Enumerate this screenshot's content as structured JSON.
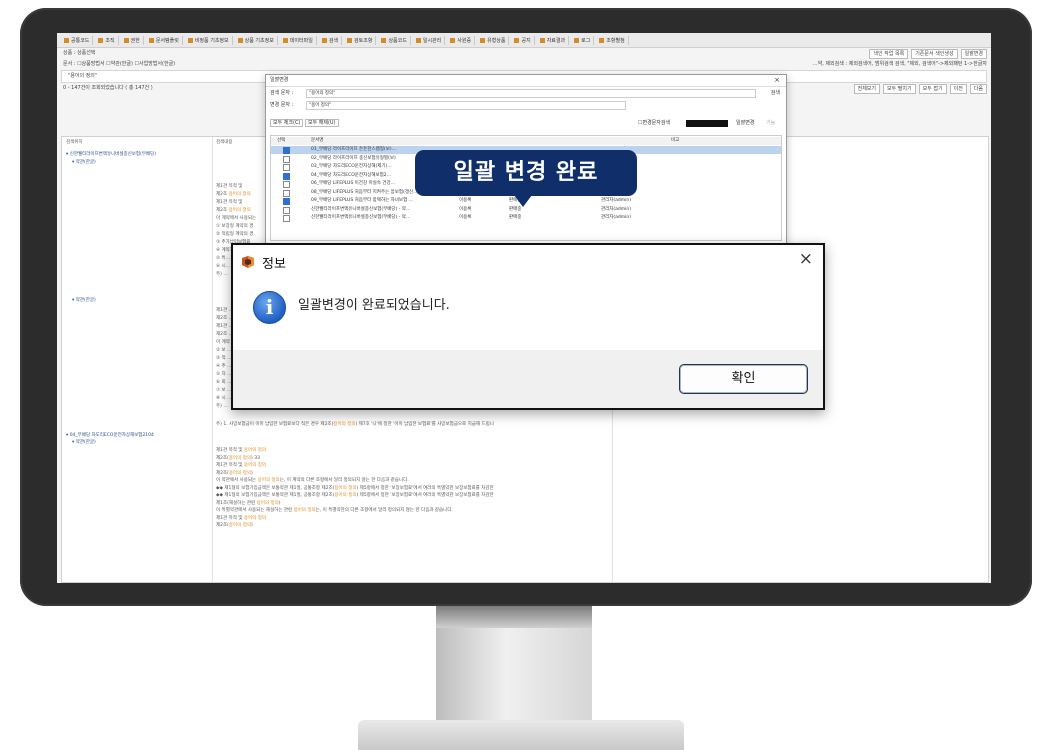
{
  "toolbar_items": [
    "공통코드",
    "조직",
    "권한",
    "문서템플릿",
    "비정품 기초정보",
    "상품 기초정보",
    "데이터파일",
    "검색",
    "검토조항",
    "상품코드",
    "일시관리",
    "사원증",
    "유형상품",
    "공지",
    "자료결과",
    "로그",
    "조항별첨"
  ],
  "filter_row": {
    "label1": "상품 :",
    "value1": "상품선택",
    "right_buttons": [
      "색인 작업 목록",
      "기존문서 색인생성",
      "일괄변경"
    ]
  },
  "option_row": {
    "text": "문서 : ☐상품방법서 ☐약관(한글) ☐사업방법서(한글)",
    "right_text": "…약, 제외검색 : 제외검색어, 범위검색 검색, \"제외, 검색어\"->제외패턴 1->한글자"
  },
  "search_value": "\"용어의 정의\"",
  "result_count": "0 - 147건이 조회되었습니다 ( 총 147건 )",
  "result_buttons": [
    "전체보기",
    "모두 펼치기",
    "모두 접기",
    "이전",
    "다음"
  ],
  "grid": {
    "col1_header": "검색위치",
    "col2_header": "검색내용",
    "tree_group1": "▾ 신한웰티라이프변액유니버셜종신보험(무배당)",
    "tree_sub1": "▾ 약관(한글)",
    "tree_sub2": "▾ 약관(한글)",
    "tree_group2": "▾ 04_무배당 차도리ECO운전자상해보험2104",
    "tree_sub3": "▾ 약관(한글)",
    "lines_top": [
      "제1관 목적 및",
      "제2조 용어의 정의",
      "제1관 목적 및",
      "제2조 용어의 정의",
      "이 계약에서 사용되는",
      "① 보장형 계약의 경",
      "② 적립형 계약의 경",
      "③ 추가납입보험료",
      "④ 계약자가 납입한",
      "⑤ 특…",
      "⑥ 시…",
      "주) …"
    ],
    "lines_mid": [
      "제1관 …",
      "제2조 …",
      "제1관 …",
      "제2조 …",
      "이 계약 …",
      "② 보 …",
      "③ 적 …",
      "④ 추 …",
      "⑤ 자 …",
      "⑥ 회 …",
      "⑦ 보 …",
      "⑧ 시 …",
      "주) …"
    ],
    "line_note": "주) 1. 사망보험금이 이미 납입한 보험료보다 적은 경우 제2조(용어의 정의) 제7호 '나'에 정한 '이미 납입한 보험료'를 사망보험금으로 지급해 드립니",
    "lines_bottom": [
      "제1관 목적 및 용어의 정의",
      "제2조(용어의 정의) 33",
      "제1관 목적 및 용어의 정의",
      "제2조(용어의 정의)",
      "이 약관에서 사용되는 용어의 정의는, 이 계약의 다른 조항에서 달리 정의되지 않는 한 다음과 같습니다.",
      "◆◆ 제1형의 보험기입금액은 보통약관 제1절, 공통조항 제2조(용어의 정의) 제5항에서 정한 '보장보험료'에서 여러의 특별약관 보장보험료를 차감한",
      "◆◆ 제1형의 보험기입금액은 보통약관 제1절, 공통조항 제2조(용어의 정의) 제5항에서 정한 '보장보험료'에서 여러의 특별약관 보장보험료를 차감한",
      "제1조(해설하는 관련 용어의 정의)",
      "이 특별약관에서 사용되는 해설하는 관련 용어의 정의는, 이 특별약관의 다른 조항에서 달리 정의되지 않는 한 다음과 같습니다.",
      "제1관 목적 및 용어의 정의",
      "제2조(용어의 정의)"
    ]
  },
  "bg_dialog": {
    "title": "일괄변경",
    "close": "×",
    "search_label": "검색 문자 :",
    "search_value": "\"용어의 정의\"",
    "search_btn": "검색",
    "change_label": "변경 문자 :",
    "change_value": "\"용어 정의\"",
    "select_all": "모두 체크(C)",
    "deselect_all": "모두 해제(U)",
    "change_check_label": "☐변경문자검색",
    "bulk_btn": "일괄변경",
    "other_btn": "기능",
    "col_select": "선택",
    "col_doc": "문서명",
    "col_note": "비고",
    "rows": [
      {
        "checked": true,
        "selected": true,
        "name": "01_무배당 라이프라이프 든든한스팸형(보)…",
        "author": "",
        "status": "",
        "admin": ""
      },
      {
        "checked": false,
        "selected": false,
        "name": "02_무배당 라이프라이프 종신보험유형별(보)",
        "author": "",
        "status": "",
        "admin": ""
      },
      {
        "checked": false,
        "selected": false,
        "name": "03_무배당 차도리ECO운전자상해(제기)…",
        "author": "",
        "status": "",
        "admin": ""
      },
      {
        "checked": true,
        "selected": false,
        "name": "04_무배당 차도리ECO운전자상해보험2…",
        "author": "",
        "status": "",
        "admin": ""
      },
      {
        "checked": false,
        "selected": false,
        "name": "06_무배당 LIFEPLUS 이건강 미실속 건강…",
        "author": "",
        "status": "",
        "admin": ""
      },
      {
        "checked": false,
        "selected": false,
        "name": "08_무배당 LIFEPLUS 처음부터 지켜주는 암보험(갱신…",
        "author": "이용록",
        "status": "판매중",
        "admin": "관리자(admin)"
      },
      {
        "checked": true,
        "selected": false,
        "name": "09_무배당 LIFEPLUS 처음부터 함께하는 자녀보험 …",
        "author": "이용록",
        "status": "판매중",
        "admin": "관리자(admin)"
      },
      {
        "checked": false,
        "selected": false,
        "name": "신한웰티라이프변액유니버셜종신보험(무배당) - 약…",
        "author": "이용록",
        "status": "판매중",
        "admin": "관리자(admin)"
      },
      {
        "checked": false,
        "selected": false,
        "name": "신한웰티라이프변액유니버셜종신보험(무배당) - 약…",
        "author": "이용록",
        "status": "판매중",
        "admin": "관리자(admin)"
      }
    ]
  },
  "callout": {
    "text": "일괄 변경 완료",
    "color": "#0f2e6a"
  },
  "message_box": {
    "title": "정보",
    "message": "일괄변경이 완료되었습니다.",
    "ok": "확인",
    "close": "×",
    "icon": "info-icon",
    "app_icon": "app-logo-icon"
  }
}
